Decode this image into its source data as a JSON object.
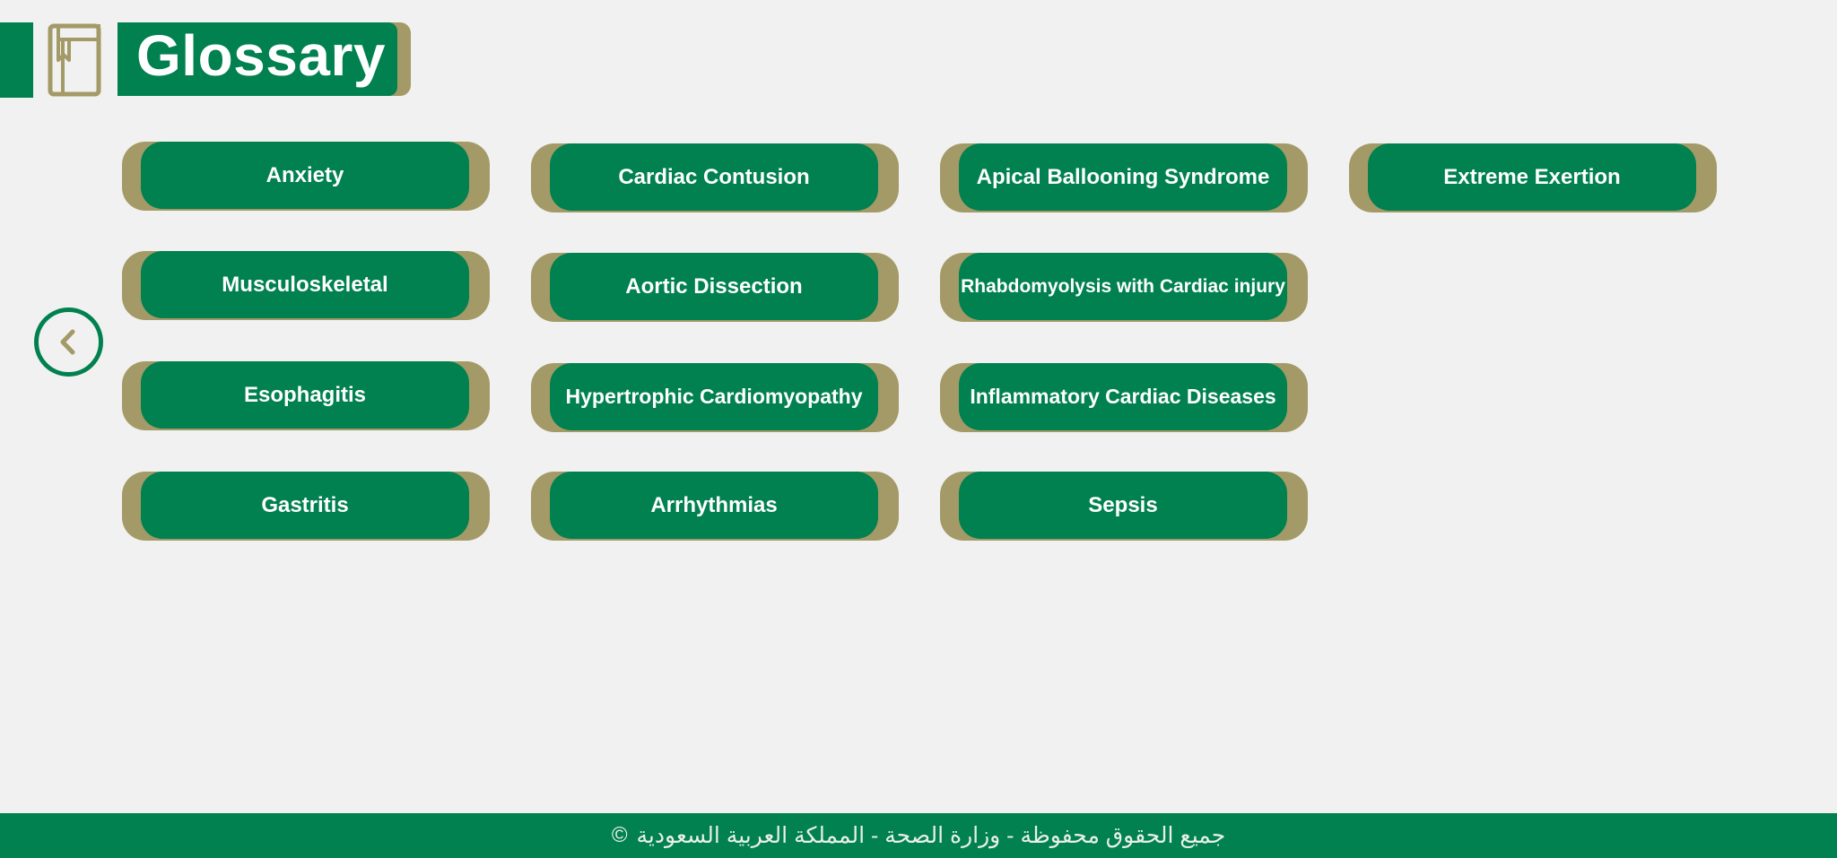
{
  "header": {
    "title": "Glossary",
    "icon": "book-icon"
  },
  "navigation": {
    "back_icon": "chevron-left-icon"
  },
  "glossary": {
    "items": [
      {
        "label": "Anxiety"
      },
      {
        "label": "Cardiac Contusion"
      },
      {
        "label": "Apical Ballooning Syndrome"
      },
      {
        "label": "Extreme Exertion"
      },
      {
        "label": "Musculoskeletal"
      },
      {
        "label": "Aortic Dissection"
      },
      {
        "label": "Rhabdomyolysis with Cardiac injury"
      },
      {
        "label": "Esophagitis"
      },
      {
        "label": "Hypertrophic Cardiomyopathy"
      },
      {
        "label": "Inflammatory Cardiac Diseases"
      },
      {
        "label": "Gastritis"
      },
      {
        "label": "Arrhythmias"
      },
      {
        "label": "Sepsis"
      }
    ]
  },
  "footer": {
    "text": "جميع الحقوق محفوظة - وزارة الصحة - المملكة العربية السعودية",
    "copyright_symbol": "©",
    "icon": "copyright-icon"
  },
  "colors": {
    "primary_green": "#00814f",
    "accent_gold": "#a39a67",
    "background": "#f0f1f0"
  }
}
